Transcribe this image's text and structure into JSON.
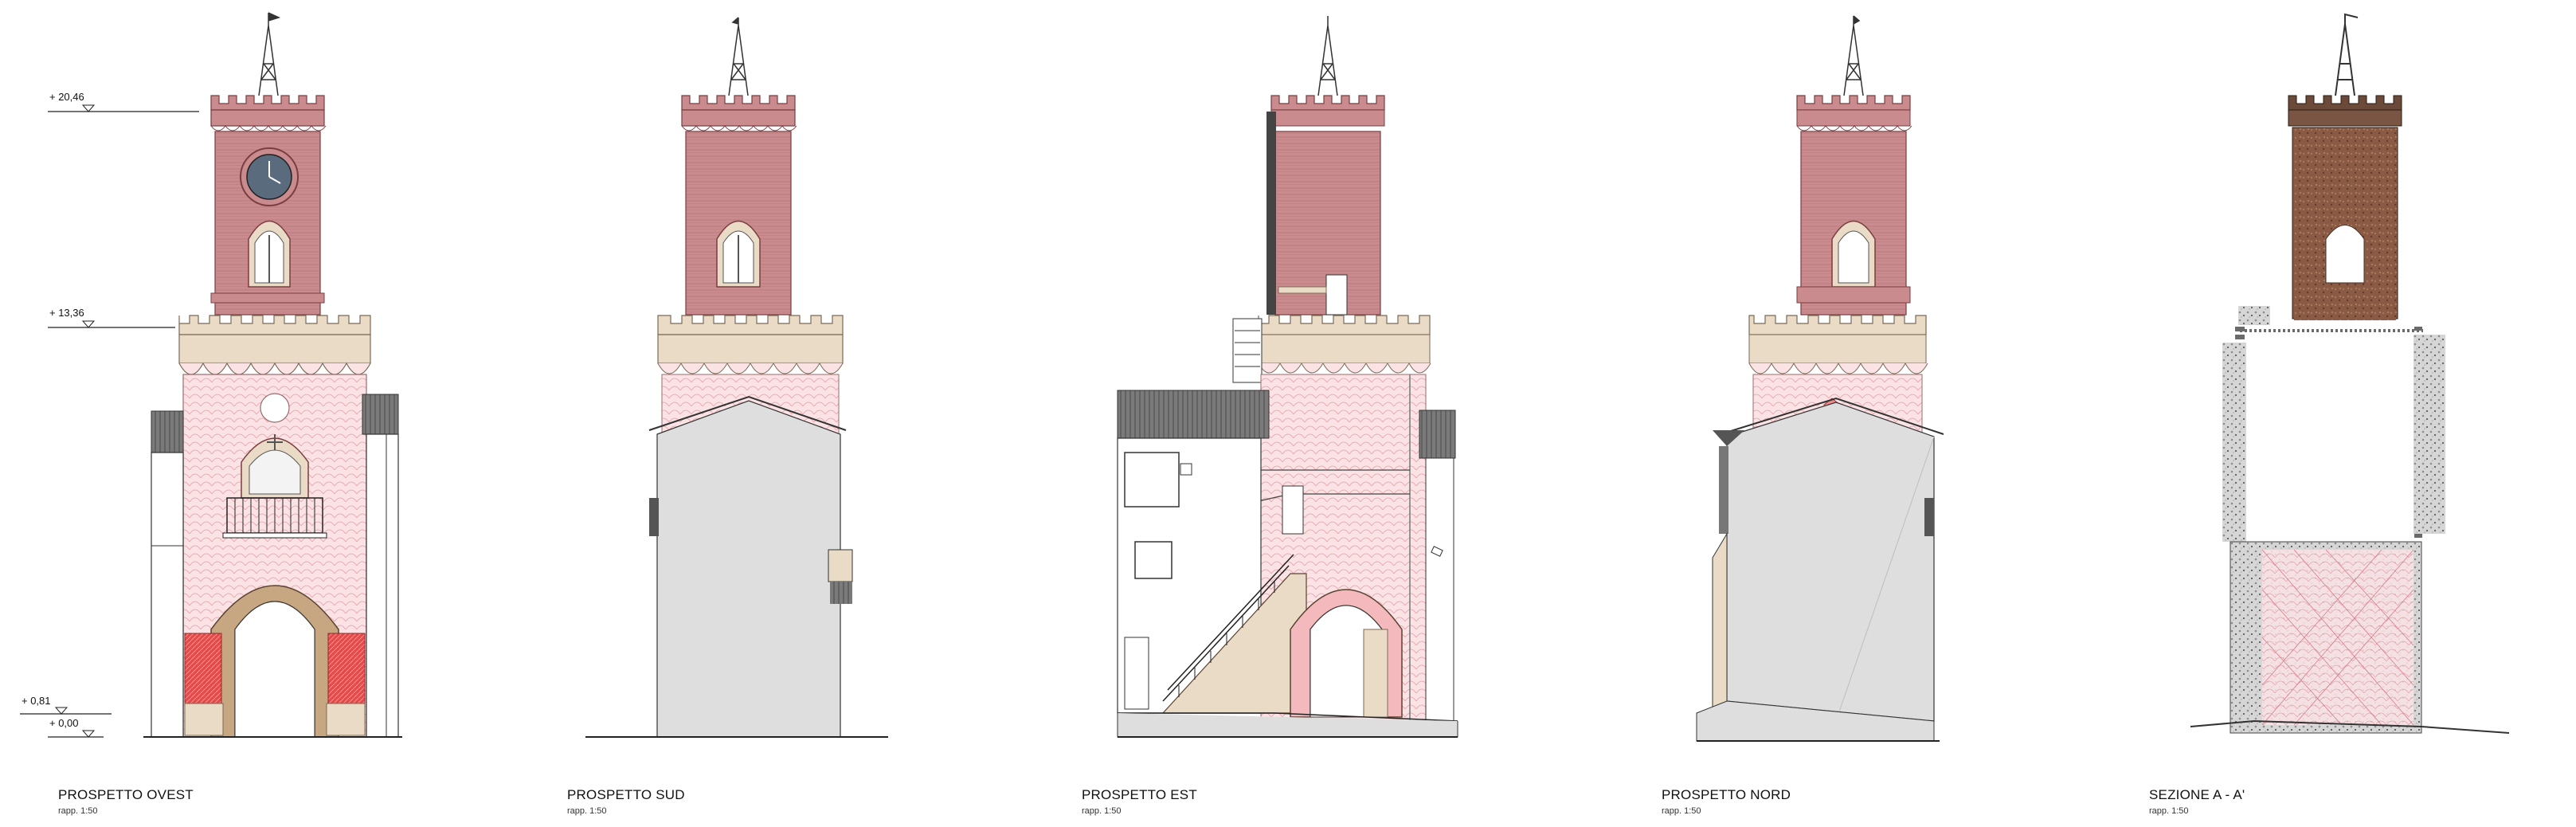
{
  "levels": [
    {
      "label": "+ 20,46"
    },
    {
      "label": "+ 13,36"
    },
    {
      "label": "+ 0,81"
    },
    {
      "label": "+ 0,00"
    }
  ],
  "views": [
    {
      "title": "PROSPETTO OVEST",
      "scale": "rapp. 1:50"
    },
    {
      "title": "PROSPETTO SUD",
      "scale": "rapp. 1:50"
    },
    {
      "title": "PROSPETTO EST",
      "scale": "rapp. 1:50"
    },
    {
      "title": "PROSPETTO NORD",
      "scale": "rapp. 1:50"
    },
    {
      "title": "SEZIONE A - A'",
      "scale": "rapp. 1:50"
    }
  ],
  "colors": {
    "brick_red": "#c98b8d",
    "brick_hatch": "#b04a52",
    "stone_beige": "#eadbc6",
    "plaster_pink": "#f7d7da",
    "wall_grey": "#dedede",
    "roof_dark": "#6d6d6d",
    "arch_ochre": "#c7a781",
    "stripe_red": "#e23b3b"
  }
}
